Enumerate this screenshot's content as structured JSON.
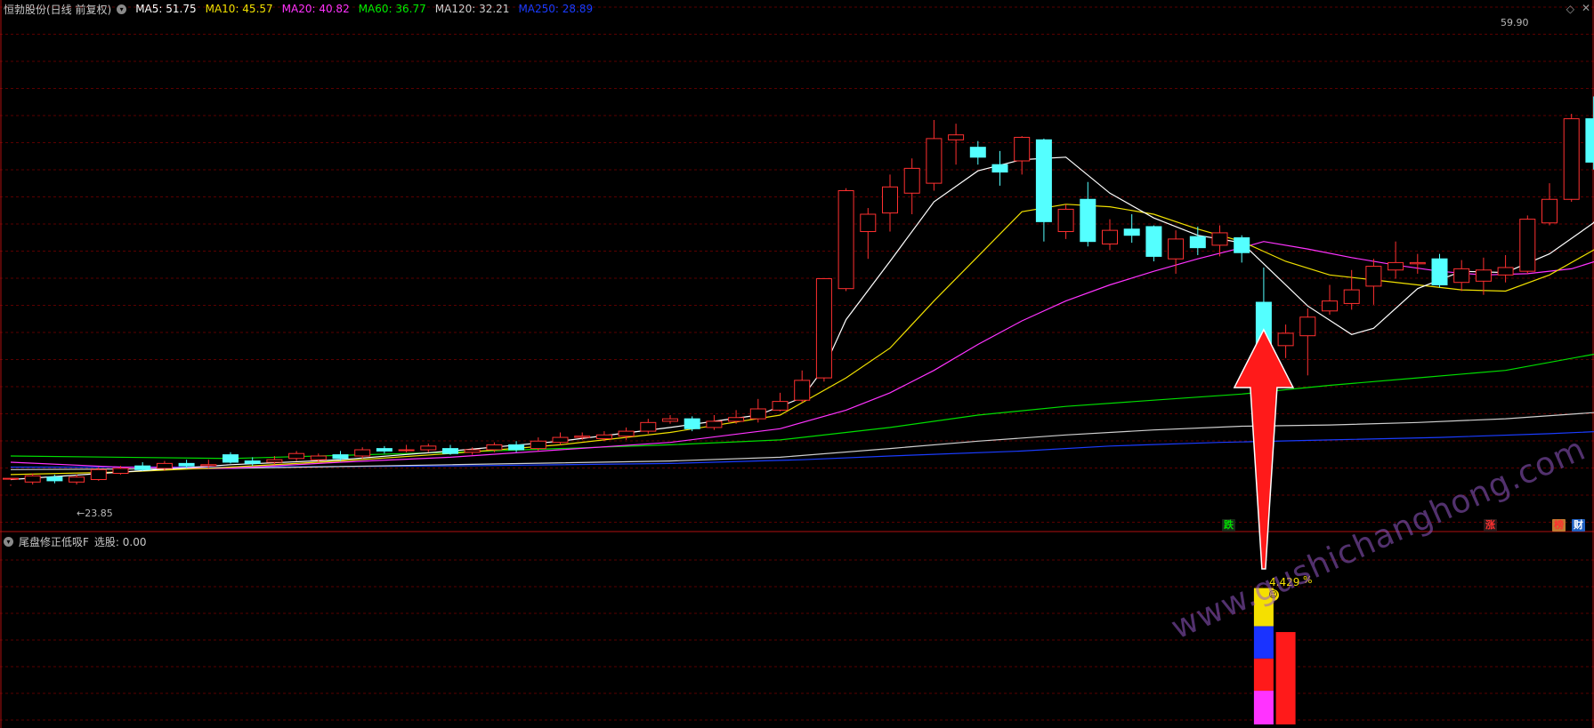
{
  "header": {
    "title": "恒勃股份(日线 前复权)",
    "ma_values": [
      {
        "label": "MA5: 51.75",
        "color": "#ffffff"
      },
      {
        "label": "MA10: 45.57",
        "color": "#f0e000"
      },
      {
        "label": "MA20: 40.82",
        "color": "#ff33ff"
      },
      {
        "label": "MA60: 36.77",
        "color": "#00ee00"
      },
      {
        "label": "MA120: 32.21",
        "color": "#d0d0d0"
      },
      {
        "label": "MA250: 28.89",
        "color": "#1a3cff"
      }
    ]
  },
  "price_labels": {
    "high": "59.90",
    "low": "23.85"
  },
  "tags": {
    "drop": "跌",
    "rise": "涨",
    "rank": "榜",
    "finance": "财"
  },
  "indicator": {
    "title": "尾盘修正低吸F",
    "value_text": "选股: 0.00",
    "percent": "4.429",
    "percent_unit": "%",
    "smiley": "☺"
  },
  "watermark": "www.gushichanghong.com",
  "colors": {
    "up": "#ff3030",
    "down": "#54ffff",
    "ma5": "#ffffff",
    "ma10": "#f0e000",
    "ma20": "#ff33ff",
    "ma60": "#00dd00",
    "ma120": "#cfcfcf",
    "ma250": "#1a3cff",
    "arrow": "#ff1a1a"
  },
  "chart_data": {
    "type": "candlestick",
    "title": "恒勃股份(日线 前复权)",
    "ylim": [
      22.5,
      61.5
    ],
    "high_marker": 59.9,
    "low_marker": 23.85,
    "candles": [
      [
        24.5,
        24.5,
        24.0,
        23.9
      ],
      [
        24.2,
        24.7,
        24.9,
        24.0
      ],
      [
        24.6,
        24.3,
        24.8,
        24.1
      ],
      [
        24.2,
        24.6,
        24.8,
        24.0
      ],
      [
        24.4,
        25.2,
        25.4,
        24.3
      ],
      [
        24.9,
        25.3,
        25.5,
        24.8
      ],
      [
        25.5,
        25.2,
        25.8,
        25.1
      ],
      [
        25.3,
        25.7,
        25.9,
        25.1
      ],
      [
        25.7,
        25.5,
        26.0,
        25.3
      ],
      [
        25.5,
        25.6,
        26.0,
        25.3
      ],
      [
        26.4,
        25.8,
        26.6,
        25.7
      ],
      [
        25.9,
        25.7,
        26.2,
        25.5
      ],
      [
        25.8,
        26.0,
        26.3,
        25.6
      ],
      [
        26.1,
        26.5,
        26.7,
        25.9
      ],
      [
        26.0,
        26.3,
        26.5,
        25.8
      ],
      [
        26.4,
        26.1,
        26.7,
        25.9
      ],
      [
        26.3,
        26.8,
        27.0,
        26.1
      ],
      [
        26.9,
        26.7,
        27.1,
        26.5
      ],
      [
        26.8,
        26.8,
        27.2,
        26.6
      ],
      [
        26.8,
        27.1,
        27.3,
        26.6
      ],
      [
        26.9,
        26.5,
        27.2,
        26.4
      ],
      [
        26.6,
        26.8,
        27.0,
        26.4
      ],
      [
        26.8,
        27.2,
        27.4,
        26.6
      ],
      [
        27.2,
        26.8,
        27.5,
        26.6
      ],
      [
        26.9,
        27.5,
        27.8,
        26.7
      ],
      [
        27.4,
        27.8,
        28.2,
        27.2
      ],
      [
        27.8,
        27.9,
        28.2,
        27.6
      ],
      [
        27.7,
        28.0,
        28.3,
        27.5
      ],
      [
        27.9,
        28.3,
        28.6,
        27.6
      ],
      [
        28.3,
        29.0,
        29.3,
        28.1
      ],
      [
        29.1,
        29.3,
        29.6,
        28.9
      ],
      [
        29.3,
        28.5,
        29.5,
        28.3
      ],
      [
        28.6,
        29.1,
        29.6,
        28.4
      ],
      [
        29.1,
        29.4,
        30.0,
        28.9
      ],
      [
        29.3,
        30.1,
        30.9,
        29.0
      ],
      [
        30.0,
        30.7,
        31.4,
        29.9
      ],
      [
        30.8,
        32.4,
        33.2,
        30.6
      ],
      [
        32.6,
        40.6,
        40.6,
        32.3
      ],
      [
        39.8,
        47.7,
        47.9,
        39.6
      ],
      [
        44.4,
        45.8,
        46.3,
        42.2
      ],
      [
        45.9,
        48.0,
        49.0,
        44.4
      ],
      [
        47.5,
        49.5,
        50.3,
        45.8
      ],
      [
        48.3,
        51.9,
        53.4,
        47.7
      ],
      [
        51.8,
        52.2,
        53.1,
        49.8
      ],
      [
        51.2,
        50.4,
        51.7,
        49.8
      ],
      [
        49.8,
        49.2,
        50.9,
        48.1
      ],
      [
        50.1,
        52.0,
        52.1,
        49.0
      ],
      [
        51.8,
        45.2,
        51.9,
        43.6
      ],
      [
        44.4,
        46.2,
        46.6,
        43.8
      ],
      [
        47.0,
        43.6,
        48.4,
        43.2
      ],
      [
        43.4,
        44.5,
        45.4,
        42.9
      ],
      [
        44.6,
        44.1,
        45.8,
        43.5
      ],
      [
        44.8,
        42.4,
        44.9,
        42.0
      ],
      [
        42.2,
        43.8,
        44.5,
        41.0
      ],
      [
        44.0,
        43.1,
        44.8,
        42.5
      ],
      [
        43.3,
        44.3,
        44.9,
        42.4
      ],
      [
        43.9,
        42.7,
        44.1,
        41.9
      ],
      [
        38.7,
        35.2,
        41.5,
        35.0
      ],
      [
        35.2,
        36.2,
        36.9,
        34.2
      ],
      [
        36.0,
        37.5,
        38.2,
        32.8
      ],
      [
        38.0,
        38.8,
        40.1,
        37.7
      ],
      [
        38.6,
        39.7,
        41.3,
        38.1
      ],
      [
        40.0,
        41.6,
        42.2,
        38.5
      ],
      [
        41.3,
        41.9,
        43.6,
        40.6
      ],
      [
        41.8,
        41.9,
        42.6,
        41.0
      ],
      [
        42.2,
        40.1,
        42.6,
        39.9
      ],
      [
        40.3,
        41.4,
        42.1,
        39.6
      ],
      [
        40.4,
        41.3,
        42.3,
        39.3
      ],
      [
        40.9,
        41.5,
        42.5,
        40.3
      ],
      [
        41.2,
        45.4,
        45.7,
        41.0
      ],
      [
        45.1,
        47.0,
        48.3,
        44.9
      ],
      [
        47.0,
        53.5,
        53.9,
        46.8
      ],
      [
        53.5,
        50.0,
        55.3,
        49.4
      ],
      [
        50.2,
        52.8,
        54.5,
        50.0
      ],
      [
        52.2,
        56.1,
        57.9,
        51.9
      ],
      [
        55.9,
        57.1,
        59.9,
        55.8
      ]
    ],
    "ma5": [
      [
        0,
        24.4
      ],
      [
        5,
        25.0
      ],
      [
        10,
        25.6
      ],
      [
        15,
        26.0
      ],
      [
        20,
        26.7
      ],
      [
        25,
        27.5
      ],
      [
        30,
        28.6
      ],
      [
        34,
        29.6
      ],
      [
        36,
        31.0
      ],
      [
        37,
        33.4
      ],
      [
        38,
        37.3
      ],
      [
        40,
        42.0
      ],
      [
        42,
        46.8
      ],
      [
        44,
        49.3
      ],
      [
        46,
        50.2
      ],
      [
        48,
        50.4
      ],
      [
        50,
        47.5
      ],
      [
        52,
        45.5
      ],
      [
        54,
        44.1
      ],
      [
        56,
        43.5
      ],
      [
        57,
        41.8
      ],
      [
        59,
        38.4
      ],
      [
        61,
        36.1
      ],
      [
        62,
        36.6
      ],
      [
        64,
        39.8
      ],
      [
        66,
        41.2
      ],
      [
        68,
        41.1
      ],
      [
        70,
        42.6
      ],
      [
        72,
        45.1
      ],
      [
        75,
        52.0
      ]
    ],
    "ma10": [
      [
        0,
        24.8
      ],
      [
        5,
        25.0
      ],
      [
        10,
        25.4
      ],
      [
        15,
        25.9
      ],
      [
        20,
        26.5
      ],
      [
        25,
        27.2
      ],
      [
        30,
        28.2
      ],
      [
        35,
        29.6
      ],
      [
        38,
        32.6
      ],
      [
        40,
        35.0
      ],
      [
        42,
        38.8
      ],
      [
        44,
        42.4
      ],
      [
        46,
        46.0
      ],
      [
        48,
        46.6
      ],
      [
        50,
        46.4
      ],
      [
        52,
        45.8
      ],
      [
        54,
        44.6
      ],
      [
        56,
        43.6
      ],
      [
        58,
        42.0
      ],
      [
        60,
        40.9
      ],
      [
        62,
        40.5
      ],
      [
        64,
        40.1
      ],
      [
        66,
        39.7
      ],
      [
        68,
        39.6
      ],
      [
        70,
        40.9
      ],
      [
        72,
        42.9
      ],
      [
        75,
        45.6
      ]
    ],
    "ma20": [
      [
        0,
        25.8
      ],
      [
        5,
        25.4
      ],
      [
        10,
        25.3
      ],
      [
        15,
        25.8
      ],
      [
        20,
        26.2
      ],
      [
        25,
        26.8
      ],
      [
        30,
        27.4
      ],
      [
        35,
        28.5
      ],
      [
        38,
        30.0
      ],
      [
        40,
        31.4
      ],
      [
        42,
        33.2
      ],
      [
        44,
        35.3
      ],
      [
        46,
        37.2
      ],
      [
        48,
        38.8
      ],
      [
        50,
        40.1
      ],
      [
        52,
        41.2
      ],
      [
        54,
        42.2
      ],
      [
        56,
        43.1
      ],
      [
        57,
        43.6
      ],
      [
        59,
        43.0
      ],
      [
        61,
        42.3
      ],
      [
        63,
        41.7
      ],
      [
        65,
        41.2
      ],
      [
        67,
        40.9
      ],
      [
        69,
        41.0
      ],
      [
        71,
        41.4
      ],
      [
        73,
        42.5
      ],
      [
        75,
        43.9
      ]
    ],
    "ma60": [
      [
        0,
        26.3
      ],
      [
        10,
        26.1
      ],
      [
        20,
        26.6
      ],
      [
        30,
        27.2
      ],
      [
        35,
        27.6
      ],
      [
        40,
        28.6
      ],
      [
        44,
        29.6
      ],
      [
        48,
        30.3
      ],
      [
        52,
        30.8
      ],
      [
        56,
        31.3
      ],
      [
        60,
        32.0
      ],
      [
        64,
        32.6
      ],
      [
        68,
        33.2
      ],
      [
        72,
        34.5
      ],
      [
        75,
        35.5
      ]
    ],
    "ma120": [
      [
        0,
        25.2
      ],
      [
        10,
        25.3
      ],
      [
        20,
        25.6
      ],
      [
        30,
        25.9
      ],
      [
        35,
        26.2
      ],
      [
        40,
        26.9
      ],
      [
        44,
        27.5
      ],
      [
        48,
        28.0
      ],
      [
        52,
        28.4
      ],
      [
        56,
        28.7
      ],
      [
        60,
        28.8
      ],
      [
        64,
        29.0
      ],
      [
        68,
        29.3
      ],
      [
        72,
        29.8
      ],
      [
        75,
        30.4
      ]
    ],
    "ma250": [
      [
        0,
        25.4
      ],
      [
        10,
        25.4
      ],
      [
        20,
        25.5
      ],
      [
        30,
        25.7
      ],
      [
        36,
        26.0
      ],
      [
        40,
        26.3
      ],
      [
        46,
        26.7
      ],
      [
        50,
        27.1
      ],
      [
        55,
        27.4
      ],
      [
        60,
        27.6
      ],
      [
        65,
        27.8
      ],
      [
        70,
        28.1
      ],
      [
        75,
        28.5
      ]
    ],
    "indicator_bars": [
      {
        "day": 57,
        "segments": [
          {
            "from": 0,
            "to": 0.23,
            "color": "#ff33ff"
          },
          {
            "from": 0.23,
            "to": 0.45,
            "color": "#ff1a1a"
          },
          {
            "from": 0.45,
            "to": 0.67,
            "color": "#1a33ff"
          },
          {
            "from": 0.67,
            "to": 0.93,
            "color": "#f5e000"
          }
        ]
      },
      {
        "day": 58,
        "segments": [
          {
            "from": 0,
            "to": 0.63,
            "color": "#ff1a1a"
          }
        ]
      }
    ]
  }
}
